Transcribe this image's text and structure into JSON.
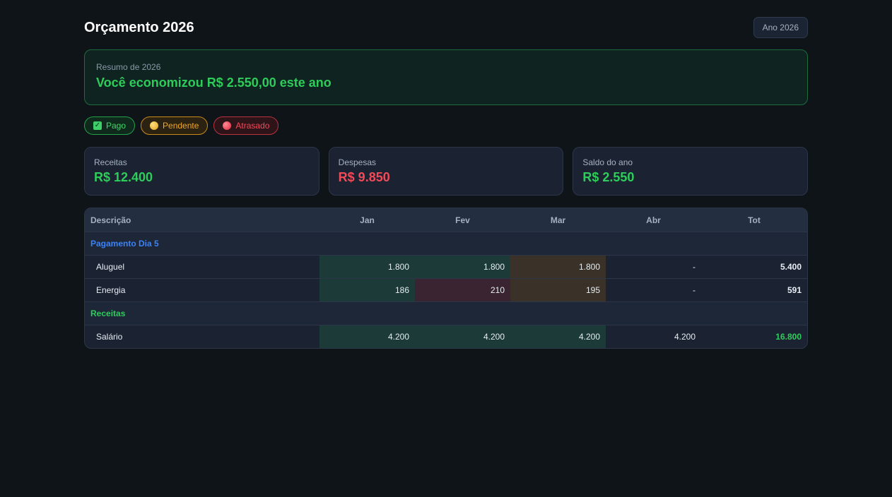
{
  "header": {
    "title": "Orçamento 2026",
    "year_button": "Ano 2026"
  },
  "summary": {
    "label": "Resumo de 2026",
    "text": "Você economizou R$ 2.550,00 este ano"
  },
  "legend": {
    "pago": "Pago",
    "pendente": "Pendente",
    "atrasado": "Atrasado"
  },
  "cards": {
    "receitas": {
      "label": "Receitas",
      "value": "R$ 12.400"
    },
    "despesas": {
      "label": "Despesas",
      "value": "R$ 9.850"
    },
    "saldo": {
      "label": "Saldo do ano",
      "value": "R$ 2.550"
    }
  },
  "table": {
    "headers": {
      "desc": "Descrição",
      "jan": "Jan",
      "fev": "Fev",
      "mar": "Mar",
      "abr": "Abr",
      "tot": "Tot"
    },
    "group1": "Pagamento Dia 5",
    "aluguel": {
      "desc": "Aluguel",
      "jan": "1.800",
      "fev": "1.800",
      "mar": "1.800",
      "abr": "-",
      "tot": "5.400"
    },
    "energia": {
      "desc": "Energia",
      "jan": "186",
      "fev": "210",
      "mar": "195",
      "abr": "-",
      "tot": "591"
    },
    "group2": "Receitas",
    "salario": {
      "desc": "Salário",
      "jan": "4.200",
      "fev": "4.200",
      "mar": "4.200",
      "abr": "4.200",
      "tot": "16.800"
    }
  },
  "colors": {
    "accent_green": "#2ecc5a",
    "accent_red": "#f04b5a",
    "accent_blue": "#3b82f6",
    "accent_orange": "#f0a82a"
  }
}
